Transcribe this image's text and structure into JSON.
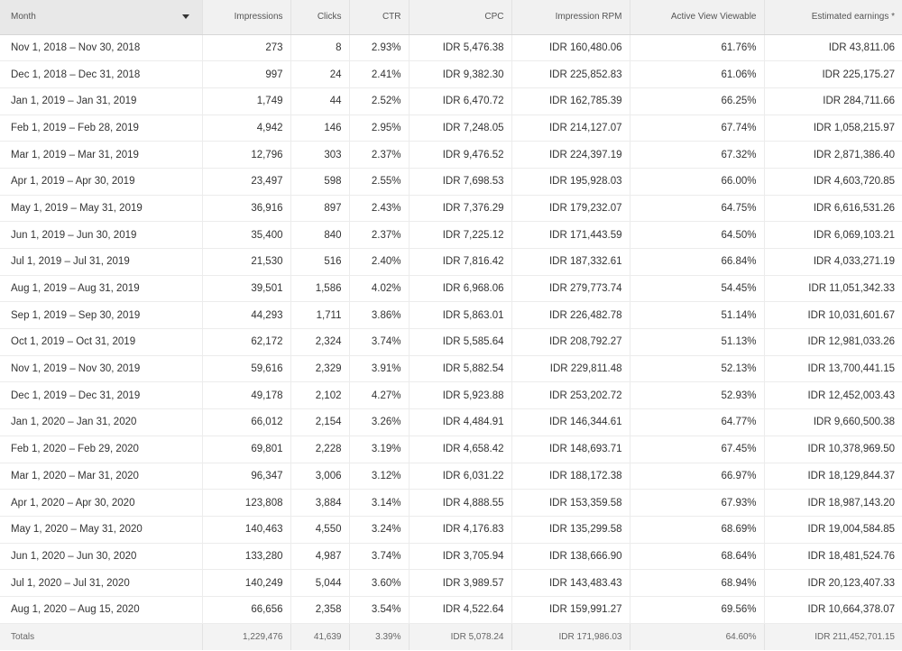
{
  "columns": [
    "Month",
    "Impressions",
    "Clicks",
    "CTR",
    "CPC",
    "Impression RPM",
    "Active View Viewable",
    "Estimated earnings *"
  ],
  "sort_icon": "sort-descending-icon",
  "rows": [
    [
      "Nov 1, 2018 – Nov 30, 2018",
      "273",
      "8",
      "2.93%",
      "IDR 5,476.38",
      "IDR 160,480.06",
      "61.76%",
      "IDR 43,811.06"
    ],
    [
      "Dec 1, 2018 – Dec 31, 2018",
      "997",
      "24",
      "2.41%",
      "IDR 9,382.30",
      "IDR 225,852.83",
      "61.06%",
      "IDR 225,175.27"
    ],
    [
      "Jan 1, 2019 – Jan 31, 2019",
      "1,749",
      "44",
      "2.52%",
      "IDR 6,470.72",
      "IDR 162,785.39",
      "66.25%",
      "IDR 284,711.66"
    ],
    [
      "Feb 1, 2019 – Feb 28, 2019",
      "4,942",
      "146",
      "2.95%",
      "IDR 7,248.05",
      "IDR 214,127.07",
      "67.74%",
      "IDR 1,058,215.97"
    ],
    [
      "Mar 1, 2019 – Mar 31, 2019",
      "12,796",
      "303",
      "2.37%",
      "IDR 9,476.52",
      "IDR 224,397.19",
      "67.32%",
      "IDR 2,871,386.40"
    ],
    [
      "Apr 1, 2019 – Apr 30, 2019",
      "23,497",
      "598",
      "2.55%",
      "IDR 7,698.53",
      "IDR 195,928.03",
      "66.00%",
      "IDR 4,603,720.85"
    ],
    [
      "May 1, 2019 – May 31, 2019",
      "36,916",
      "897",
      "2.43%",
      "IDR 7,376.29",
      "IDR 179,232.07",
      "64.75%",
      "IDR 6,616,531.26"
    ],
    [
      "Jun 1, 2019 – Jun 30, 2019",
      "35,400",
      "840",
      "2.37%",
      "IDR 7,225.12",
      "IDR 171,443.59",
      "64.50%",
      "IDR 6,069,103.21"
    ],
    [
      "Jul 1, 2019 – Jul 31, 2019",
      "21,530",
      "516",
      "2.40%",
      "IDR 7,816.42",
      "IDR 187,332.61",
      "66.84%",
      "IDR 4,033,271.19"
    ],
    [
      "Aug 1, 2019 – Aug 31, 2019",
      "39,501",
      "1,586",
      "4.02%",
      "IDR 6,968.06",
      "IDR 279,773.74",
      "54.45%",
      "IDR 11,051,342.33"
    ],
    [
      "Sep 1, 2019 – Sep 30, 2019",
      "44,293",
      "1,711",
      "3.86%",
      "IDR 5,863.01",
      "IDR 226,482.78",
      "51.14%",
      "IDR 10,031,601.67"
    ],
    [
      "Oct 1, 2019 – Oct 31, 2019",
      "62,172",
      "2,324",
      "3.74%",
      "IDR 5,585.64",
      "IDR 208,792.27",
      "51.13%",
      "IDR 12,981,033.26"
    ],
    [
      "Nov 1, 2019 – Nov 30, 2019",
      "59,616",
      "2,329",
      "3.91%",
      "IDR 5,882.54",
      "IDR 229,811.48",
      "52.13%",
      "IDR 13,700,441.15"
    ],
    [
      "Dec 1, 2019 – Dec 31, 2019",
      "49,178",
      "2,102",
      "4.27%",
      "IDR 5,923.88",
      "IDR 253,202.72",
      "52.93%",
      "IDR 12,452,003.43"
    ],
    [
      "Jan 1, 2020 – Jan 31, 2020",
      "66,012",
      "2,154",
      "3.26%",
      "IDR 4,484.91",
      "IDR 146,344.61",
      "64.77%",
      "IDR 9,660,500.38"
    ],
    [
      "Feb 1, 2020 – Feb 29, 2020",
      "69,801",
      "2,228",
      "3.19%",
      "IDR 4,658.42",
      "IDR 148,693.71",
      "67.45%",
      "IDR 10,378,969.50"
    ],
    [
      "Mar 1, 2020 – Mar 31, 2020",
      "96,347",
      "3,006",
      "3.12%",
      "IDR 6,031.22",
      "IDR 188,172.38",
      "66.97%",
      "IDR 18,129,844.37"
    ],
    [
      "Apr 1, 2020 – Apr 30, 2020",
      "123,808",
      "3,884",
      "3.14%",
      "IDR 4,888.55",
      "IDR 153,359.58",
      "67.93%",
      "IDR 18,987,143.20"
    ],
    [
      "May 1, 2020 – May 31, 2020",
      "140,463",
      "4,550",
      "3.24%",
      "IDR 4,176.83",
      "IDR 135,299.58",
      "68.69%",
      "IDR 19,004,584.85"
    ],
    [
      "Jun 1, 2020 – Jun 30, 2020",
      "133,280",
      "4,987",
      "3.74%",
      "IDR 3,705.94",
      "IDR 138,666.90",
      "68.64%",
      "IDR 18,481,524.76"
    ],
    [
      "Jul 1, 2020 – Jul 31, 2020",
      "140,249",
      "5,044",
      "3.60%",
      "IDR 3,989.57",
      "IDR 143,483.43",
      "68.94%",
      "IDR 20,123,407.33"
    ],
    [
      "Aug 1, 2020 – Aug 15, 2020",
      "66,656",
      "2,358",
      "3.54%",
      "IDR 4,522.64",
      "IDR 159,991.27",
      "69.56%",
      "IDR 10,664,378.07"
    ]
  ],
  "totals": [
    "Totals",
    "1,229,476",
    "41,639",
    "3.39%",
    "IDR 5,078.24",
    "IDR 171,986.03",
    "64.60%",
    "IDR 211,452,701.15"
  ]
}
